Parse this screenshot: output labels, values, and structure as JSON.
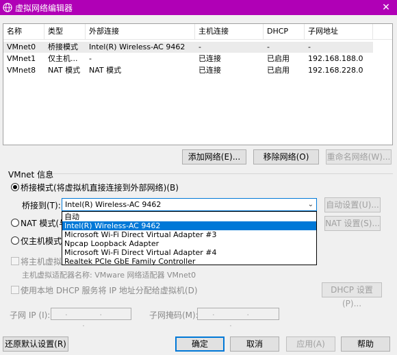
{
  "window": {
    "title": "虚拟网络编辑器",
    "close_glyph": "✕"
  },
  "table": {
    "headers": [
      "名称",
      "类型",
      "外部连接",
      "主机连接",
      "DHCP",
      "子网地址"
    ],
    "rows": [
      [
        "VMnet0",
        "桥接模式",
        "Intel(R) Wireless-AC 9462",
        "-",
        "-",
        "-"
      ],
      [
        "VMnet1",
        "仅主机...",
        "-",
        "已连接",
        "已启用",
        "192.168.188.0"
      ],
      [
        "VMnet8",
        "NAT 模式",
        "NAT 模式",
        "已连接",
        "已启用",
        "192.168.228.0"
      ]
    ]
  },
  "list_buttons": {
    "add": "添加网络(E)...",
    "remove": "移除网络(O)",
    "rename": "重命名网络(W)..."
  },
  "vmnet_info": {
    "title": "VMnet 信息",
    "bridged_label": "桥接模式(将虚拟机直接连接到外部网络)(B)",
    "bridge_to_label": "桥接到(T):",
    "bridge_to_value": "Intel(R) Wireless-AC 9462",
    "auto_settings": "自动设置(U)...",
    "nat_label": "NAT 模式(与",
    "nat_settings": "NAT 设置(S)...",
    "hostonly_label": "仅主机模式",
    "connect_host_label": "将主机虚拟",
    "host_adapter_label": "主机虚拟适配器名称: VMware 网络适配器 VMnet0",
    "dhcp_label": "使用本地 DHCP 服务将 IP 地址分配给虚拟机(D)",
    "dhcp_settings": "DHCP 设置(P)...",
    "subnet_ip_label": "子网 IP (I):",
    "subnet_ip_value": ". . .",
    "subnet_mask_label": "子网掩码(M):",
    "subnet_mask_value": ". . ."
  },
  "dropdown_options": [
    "自动",
    "Intel(R) Wireless-AC 9462",
    "Microsoft Wi-Fi Direct Virtual Adapter #3",
    "Npcap Loopback Adapter",
    "Microsoft Wi-Fi Direct Virtual Adapter #4",
    "Realtek PCIe GbE Family Controller"
  ],
  "footer": {
    "restore": "还原默认设置(R)",
    "ok": "确定",
    "cancel": "取消",
    "apply": "应用(A)",
    "help": "帮助"
  },
  "colors": {
    "titlebar": "#b000b6",
    "accent": "#0078d7"
  }
}
